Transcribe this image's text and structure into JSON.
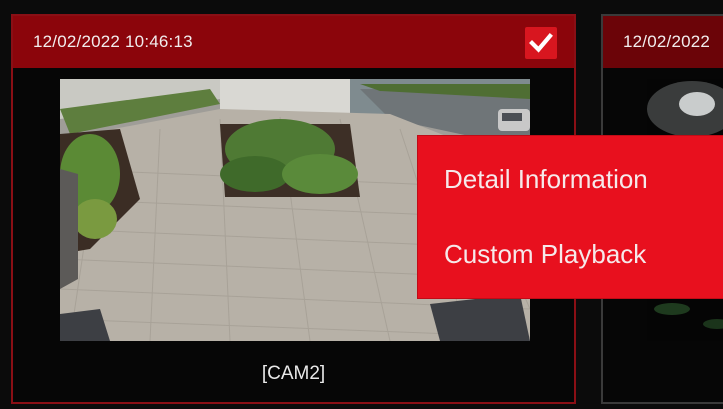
{
  "cards": [
    {
      "timestamp": "12/02/2022 10:46:13",
      "camera_label": "[CAM2]",
      "selected": true
    },
    {
      "timestamp": "12/02/2022",
      "selected": false
    }
  ],
  "context_menu": {
    "items": [
      {
        "label": "Detail Information"
      },
      {
        "label": "Custom Playback"
      }
    ]
  },
  "icons": {
    "selection": "checkmark-icon"
  },
  "colors": {
    "header_red": "#8b050b",
    "menu_red": "#e8101e",
    "checkbox_red": "#d8161f",
    "background": "#0b0b0b"
  }
}
